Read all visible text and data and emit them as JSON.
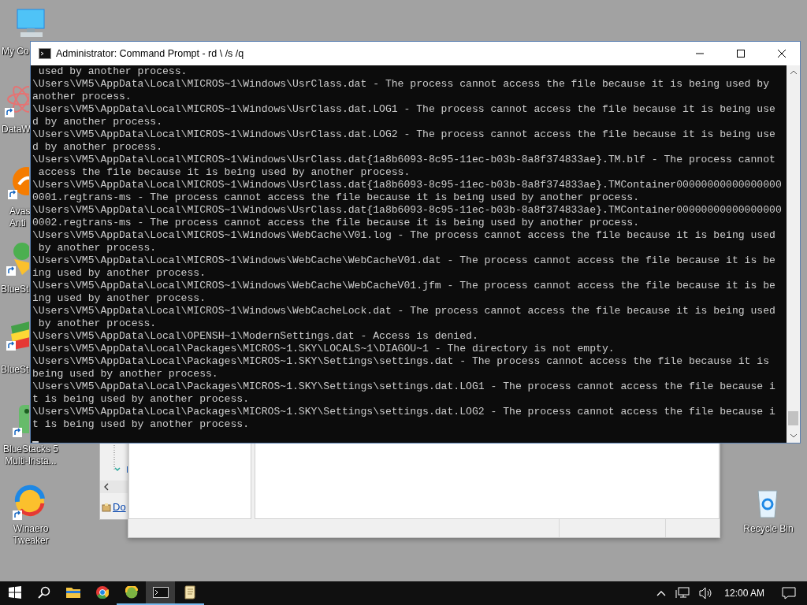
{
  "desktop_icons": [
    {
      "kind": "computer",
      "shortcut": false,
      "label": [
        "My Co"
      ]
    },
    {
      "kind": "atom",
      "shortcut": true,
      "label": [
        "DataW"
      ]
    },
    {
      "kind": "shield",
      "shortcut": true,
      "label": [
        "Avas",
        "Anti"
      ]
    },
    {
      "kind": "player",
      "shortcut": true,
      "label": [
        "BlueSt"
      ]
    },
    {
      "kind": "stack",
      "shortcut": true,
      "label": [
        "BlueSt"
      ]
    },
    {
      "kind": "multi",
      "shortcut": true,
      "label": [
        "BlueStacks 5",
        "Multi-Insta..."
      ]
    },
    {
      "kind": "swirl",
      "shortcut": true,
      "label": [
        "Winaero",
        "Tweaker"
      ]
    },
    {
      "kind": "bin",
      "shortcut": false,
      "label": [
        "Recycle Bin"
      ]
    }
  ],
  "background_window": {
    "link": "Do"
  },
  "console": {
    "title": "Administrator: Command Prompt - rd \\ /s /q",
    "lines": [
      " used by another process.",
      "\\Users\\VM5\\AppData\\Local\\MICROS~1\\Windows\\UsrClass.dat - The process cannot access the file because it is being used by",
      "another process.",
      "\\Users\\VM5\\AppData\\Local\\MICROS~1\\Windows\\UsrClass.dat.LOG1 - The process cannot access the file because it is being use",
      "d by another process.",
      "\\Users\\VM5\\AppData\\Local\\MICROS~1\\Windows\\UsrClass.dat.LOG2 - The process cannot access the file because it is being use",
      "d by another process.",
      "\\Users\\VM5\\AppData\\Local\\MICROS~1\\Windows\\UsrClass.dat{1a8b6093-8c95-11ec-b03b-8a8f374833ae}.TM.blf - The process cannot",
      " access the file because it is being used by another process.",
      "\\Users\\VM5\\AppData\\Local\\MICROS~1\\Windows\\UsrClass.dat{1a8b6093-8c95-11ec-b03b-8a8f374833ae}.TMContainer00000000000000000",
      "0001.regtrans-ms - The process cannot access the file because it is being used by another process.",
      "\\Users\\VM5\\AppData\\Local\\MICROS~1\\Windows\\UsrClass.dat{1a8b6093-8c95-11ec-b03b-8a8f374833ae}.TMContainer00000000000000000",
      "0002.regtrans-ms - The process cannot access the file because it is being used by another process.",
      "\\Users\\VM5\\AppData\\Local\\MICROS~1\\Windows\\WebCache\\V01.log - The process cannot access the file because it is being used",
      " by another process.",
      "\\Users\\VM5\\AppData\\Local\\MICROS~1\\Windows\\WebCache\\WebCacheV01.dat - The process cannot access the file because it is be",
      "ing used by another process.",
      "\\Users\\VM5\\AppData\\Local\\MICROS~1\\Windows\\WebCache\\WebCacheV01.jfm - The process cannot access the file because it is be",
      "ing used by another process.",
      "\\Users\\VM5\\AppData\\Local\\MICROS~1\\Windows\\WebCacheLock.dat - The process cannot access the file because it is being used",
      " by another process.",
      "\\Users\\VM5\\AppData\\Local\\OPENSH~1\\ModernSettings.dat - Access is denied.",
      "\\Users\\VM5\\AppData\\Local\\Packages\\MICROS~1.SKY\\LOCALS~1\\DIAGOU~1 - The directory is not empty.",
      "\\Users\\VM5\\AppData\\Local\\Packages\\MICROS~1.SKY\\Settings\\settings.dat - The process cannot access the file because it is",
      "being used by another process.",
      "\\Users\\VM5\\AppData\\Local\\Packages\\MICROS~1.SKY\\Settings\\settings.dat.LOG1 - The process cannot access the file because i",
      "t is being used by another process.",
      "\\Users\\VM5\\AppData\\Local\\Packages\\MICROS~1.SKY\\Settings\\settings.dat.LOG2 - The process cannot access the file because i",
      "t is being used by another process."
    ]
  },
  "taskbar": {
    "apps": [
      {
        "kind": "folder",
        "running": false,
        "selected": false
      },
      {
        "kind": "browser",
        "running": false,
        "selected": false
      },
      {
        "kind": "ball",
        "running": true,
        "selected": false
      },
      {
        "kind": "terminal",
        "running": true,
        "selected": true
      },
      {
        "kind": "scroll",
        "running": true,
        "selected": false
      }
    ],
    "clock": "12:00 AM"
  }
}
